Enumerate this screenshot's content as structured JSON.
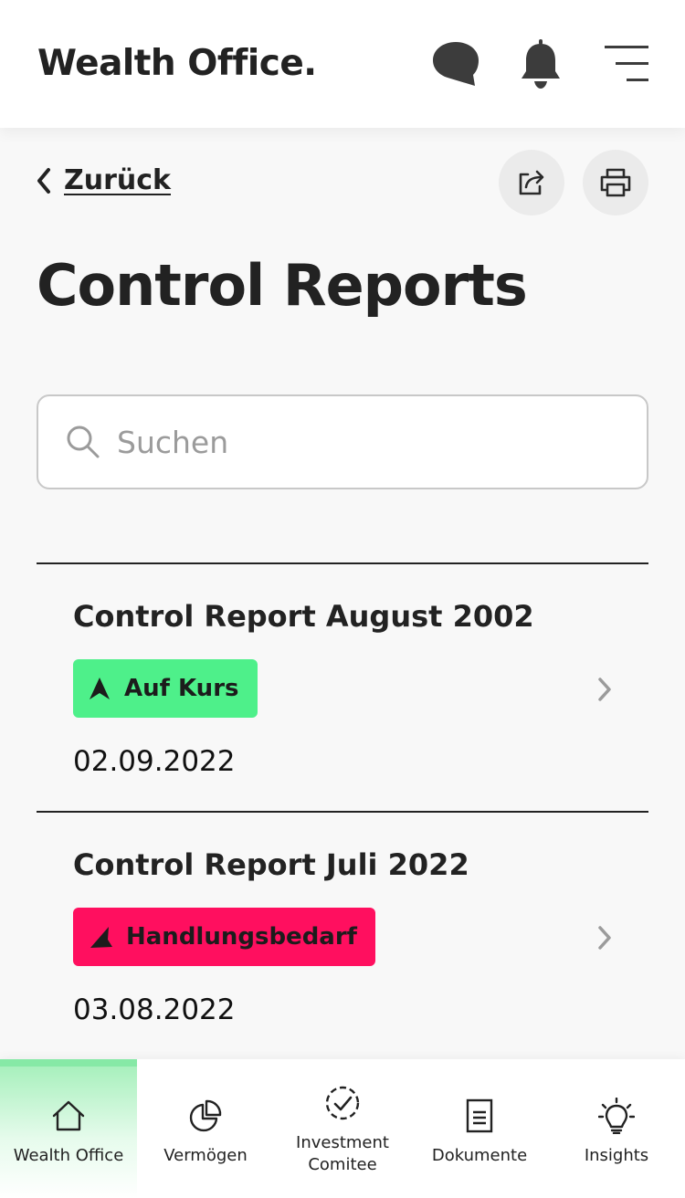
{
  "header": {
    "brand": "Wealth Office.",
    "icons": [
      "chat-icon",
      "bell-icon",
      "menu-icon"
    ]
  },
  "toolbar": {
    "back_label": "Zurück",
    "icons": [
      "share-icon",
      "print-icon"
    ]
  },
  "page": {
    "title": "Control Reports"
  },
  "search": {
    "placeholder": "Suchen",
    "value": ""
  },
  "reports": [
    {
      "title": "Control Report August 2002",
      "status": "Auf Kurs",
      "status_color": "#4ef08a",
      "date": "02.09.2022"
    },
    {
      "title": "Control Report Juli 2022",
      "status": "Handlungsbedarf",
      "status_color": "#ff0f5f",
      "date": "03.08.2022"
    }
  ],
  "bottom_nav": {
    "active": "Wealth Office",
    "items": [
      {
        "label": "Wealth Office",
        "icon": "home-icon"
      },
      {
        "label": "Vermögen",
        "icon": "pie-chart-icon"
      },
      {
        "label": "Investment\nComitee",
        "label_line1": "Investment",
        "label_line2": "Comitee",
        "icon": "check-circle-icon"
      },
      {
        "label": "Dokumente",
        "icon": "document-icon"
      },
      {
        "label": "Insights",
        "icon": "lightbulb-icon"
      }
    ]
  },
  "colors": {
    "accent": "#86e9a6",
    "on_track": "#4ef08a",
    "action_needed": "#ff0f5f",
    "text": "#222222",
    "background": "#f8f8f8"
  }
}
